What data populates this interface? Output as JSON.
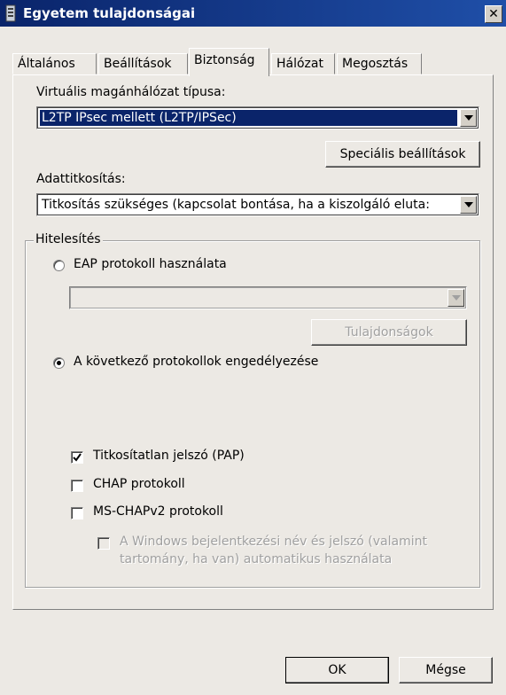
{
  "window": {
    "title": "Egyetem tulajdonságai",
    "close_label": "✕"
  },
  "tabs": [
    {
      "label": "Általános"
    },
    {
      "label": "Beállítások"
    },
    {
      "label": "Biztonság",
      "active": true
    },
    {
      "label": "Hálózat"
    },
    {
      "label": "Megosztás"
    }
  ],
  "vpn": {
    "label": "Virtuális magánhálózat típusa:",
    "value": "L2TP IPsec mellett (L2TP/IPSec)",
    "advanced_button": "Speciális beállítások"
  },
  "encryption": {
    "label": "Adattitkosítás:",
    "value": "Titkosítás szükséges (kapcsolat bontása, ha a kiszolgáló eluta:"
  },
  "auth": {
    "legend": "Hitelesítés",
    "eap_label": "EAP protokoll használata",
    "eap_value": "",
    "properties_button": "Tulajdonságok",
    "allow_label": "A következő protokollok engedélyezése",
    "protocols": [
      {
        "label": "Titkosítatlan jelszó (PAP)",
        "checked": true
      },
      {
        "label": "CHAP protokoll",
        "checked": false
      },
      {
        "label": "MS-CHAPv2  protokoll",
        "checked": false
      }
    ],
    "windows_logon_line1": "A Windows bejelentkezési név és jelszó (valamint",
    "windows_logon_line2": "tartomány, ha van) automatikus használata"
  },
  "buttons": {
    "ok": "OK",
    "cancel": "Mégse"
  },
  "colors": {
    "titlebar": "#0a246a",
    "face": "#ece9e4",
    "selection": "#0a246a"
  }
}
